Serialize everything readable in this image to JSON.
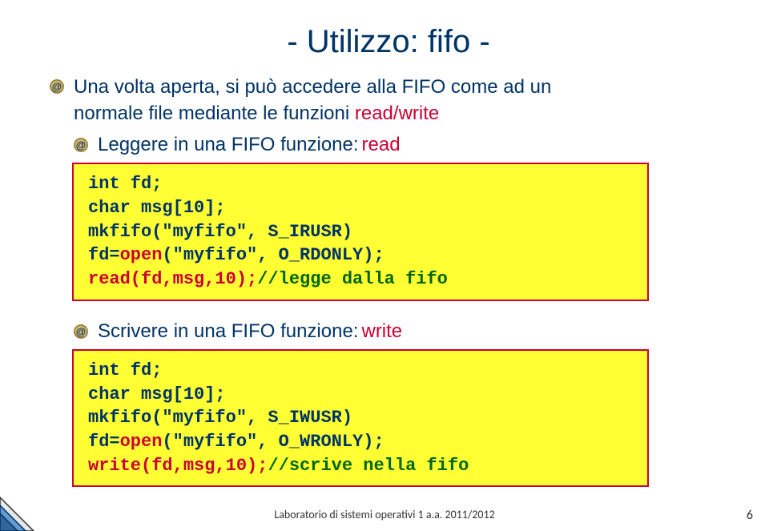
{
  "title": "- Utilizzo: fifo -",
  "para1_line1": "Una volta aperta, si può accedere alla FIFO come ad un",
  "para1_line2": "normale file mediante le funzioni ",
  "para1_keyword": "read/write",
  "heading_read_pre": " Leggere in una FIFO funzione: ",
  "heading_read_kw": "read",
  "code_read": {
    "l1": "int fd;",
    "l2": "char msg[10];",
    "l3": "mkfifo(\"myfifo\", S_IRUSR)",
    "l4a": "fd=",
    "l4b": "open",
    "l4c": "(\"myfifo\", O_RDONLY);",
    "l5a": "read(fd,msg,10);",
    "l5b": "//legge dalla fifo"
  },
  "heading_write_pre": "Scrivere in una FIFO funzione: ",
  "heading_write_kw": "write",
  "code_write": {
    "l1": "int fd;",
    "l2": "char msg[10];",
    "l3": "mkfifo(\"myfifo\", S_IWUSR)",
    "l4a": "fd=",
    "l4b": "open",
    "l4c": "(\"myfifo\", O_WRONLY);",
    "l5a": "write(fd,msg,10);",
    "l5b": "//scrive nella fifo"
  },
  "footer": "Laboratorio di sistemi operativi 1 a.a. 2011/2012",
  "page_number": "6"
}
